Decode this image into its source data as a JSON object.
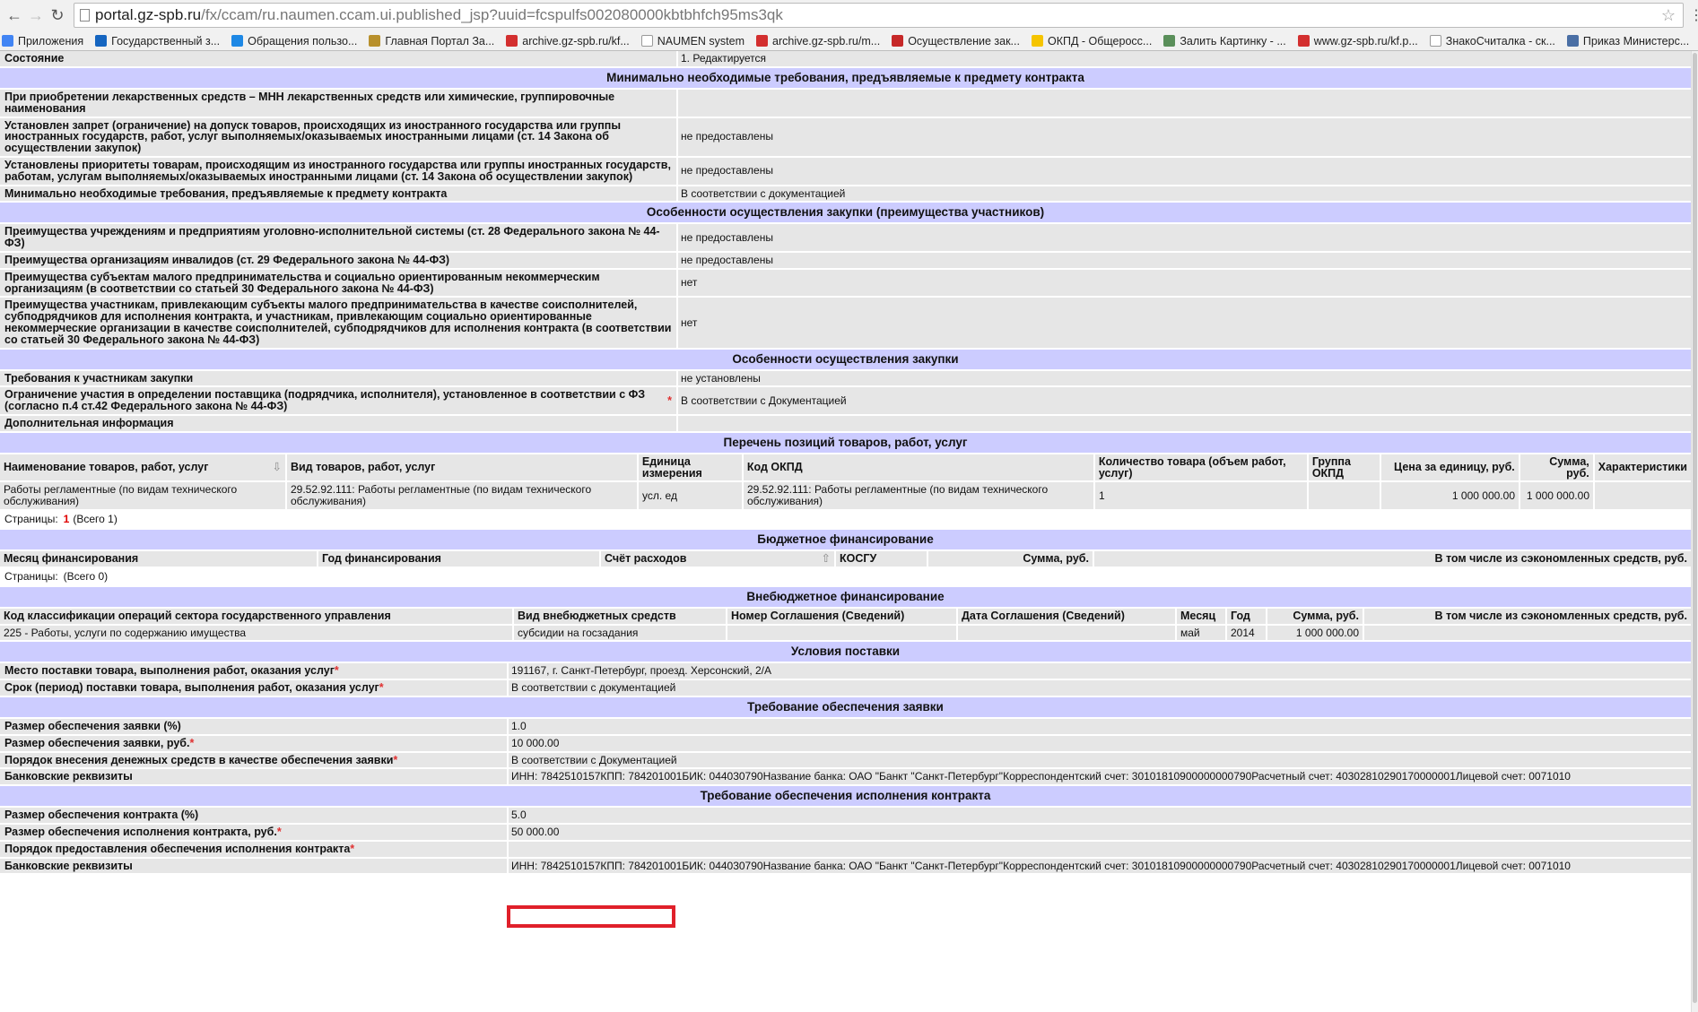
{
  "browser": {
    "url_host": "portal.gz-spb.ru",
    "url_path": "/fx/ccam/ru.naumen.ccam.ui.published_jsp?uuid=fcspulfs002080000kbtbhfch95ms3qk",
    "bookmarks": [
      {
        "label": "Приложения",
        "icon": "apps-icon",
        "color": "#4285f4"
      },
      {
        "label": "Государственный з...",
        "icon": "globe-icon",
        "color": "#1565c0"
      },
      {
        "label": "Обращения пользо...",
        "icon": "help-icon",
        "color": "#1e88e5"
      },
      {
        "label": "Главная Портал За...",
        "icon": "coat-of-arms-icon",
        "color": "#b8902c"
      },
      {
        "label": "archive.gz-spb.ru/kf...",
        "icon": "spb-emblem-icon",
        "color": "#d32f2f"
      },
      {
        "label": "NAUMEN system",
        "icon": "page-icon",
        "color": "#ffffff"
      },
      {
        "label": "archive.gz-spb.ru/m...",
        "icon": "spb-emblem-icon",
        "color": "#d32f2f"
      },
      {
        "label": "Осуществление зак...",
        "icon": "mail-icon",
        "color": "#c62828"
      },
      {
        "label": "ОКПД - Общеросс...",
        "icon": "k-logo-icon",
        "color": "#f5c400"
      },
      {
        "label": "Залить Картинку - ...",
        "icon": "image-icon",
        "color": "#5a8f5a"
      },
      {
        "label": "www.gz-spb.ru/kf.p...",
        "icon": "spb-emblem-icon",
        "color": "#d32f2f"
      },
      {
        "label": "ЗнакоСчиталка - ск...",
        "icon": "page-icon",
        "color": "#ffffff"
      },
      {
        "label": "Приказ Министерс...",
        "icon": "rg-logo-icon",
        "color": "#4a6fa5"
      }
    ]
  },
  "colors": {
    "section_header": "#ccccff",
    "row_bg": "#e6e6e6",
    "required": "#e03030",
    "highlight_box": "#e0202a"
  },
  "status_row": {
    "label": "Состояние",
    "value": "1. Редактируется"
  },
  "min_requirements": {
    "title": "Минимально необходимые требования, предъявляемые к предмету контракта",
    "rows": [
      {
        "label": "При приобретении лекарственных средств – МНН лекарственных средств или химические, группировочные наименования",
        "value": ""
      },
      {
        "label": "Установлен запрет (ограничение) на допуск товаров, происходящих из иностранного государства или группы иностранных государств, работ, услуг выполняемых/оказываемых иностранными лицами (ст. 14 Закона об осуществлении закупок)",
        "value": "не предоставлены"
      },
      {
        "label": "Установлены приоритеты товарам, происходящим из иностранного государства или группы иностранных государств, работам, услугам выполняемых/оказываемых иностранными лицами (ст. 14 Закона об осуществлении закупок)",
        "value": "не предоставлены"
      },
      {
        "label": "Минимально необходимые требования, предъявляемые к предмету контракта",
        "value": "В соответствии с документацией"
      }
    ]
  },
  "advantages": {
    "title": "Особенности осуществления закупки (преимущества участников)",
    "rows": [
      {
        "label": "Преимущества учреждениям и предприятиям уголовно-исполнительной системы (ст. 28 Федерального закона № 44-ФЗ)",
        "value": "не предоставлены"
      },
      {
        "label": "Преимущества организациям инвалидов (ст. 29 Федерального закона № 44-ФЗ)",
        "value": "не предоставлены"
      },
      {
        "label": "Преимущества субъектам малого предпринимательства и социально ориентированным некоммерческим организациям (в соответствии со статьей 30 Федерального закона № 44-ФЗ)",
        "value": "нет"
      },
      {
        "label": "Преимущества участникам, привлекающим субъекты малого предпринимательства в качестве соисполнителей, субподрядчиков для исполнения контракта, и участникам, привлекающим социально ориентированные некоммерческие организации в качестве соисполнителей, субподрядчиков для исполнения контракта (в соответствии со статьей 30 Федерального закона № 44-ФЗ)",
        "value": "нет"
      }
    ]
  },
  "features": {
    "title": "Особенности осуществления закупки",
    "rows": [
      {
        "label": "Требования к участникам закупки",
        "value": "не установлены"
      },
      {
        "label": "Ограничение участия в определении поставщика (подрядчика, исполнителя), установленное в соответствии с ФЗ (согласно п.4 ст.42 Федерального закона № 44-ФЗ)",
        "value": "В соответствии с Документацией",
        "required": "*"
      },
      {
        "label": "Дополнительная информация",
        "value": ""
      }
    ]
  },
  "goods": {
    "title": "Перечень позиций товаров, работ, услуг",
    "columns": [
      "Наименование товаров, работ, услуг",
      "Вид товаров, работ, услуг",
      "Единица измерения",
      "Код ОКПД",
      "Количество товара (объем работ, услуг)",
      "Группа ОКПД",
      "Цена за единицу, руб.",
      "Сумма, руб.",
      "Характеристики"
    ],
    "rows": [
      [
        "Работы регламентные (по видам технического обслуживания)",
        "29.52.92.111: Работы регламентные (по видам технического обслуживания)",
        "усл. ед",
        "29.52.92.111: Работы регламентные (по видам технического обслуживания)",
        "1",
        "",
        "1 000 000.00",
        "1 000 000.00",
        ""
      ]
    ],
    "pager_label": "Страницы:",
    "pager_current": "1",
    "pager_total": "(Всего 1)"
  },
  "budget": {
    "title": "Бюджетное финансирование",
    "columns": [
      "Месяц финансирования",
      "Год финансирования",
      "Счёт расходов",
      "КОСГУ",
      "Сумма, руб.",
      "В том числе из сэкономленных средств, руб."
    ],
    "pager_label": "Страницы:",
    "pager_total": "(Всего 0)"
  },
  "offbudget": {
    "title": "Внебюджетное финансирование",
    "columns": [
      "Код классификации операций сектора государственного управления",
      "Вид внебюджетных средств",
      "Номер Соглашения (Сведений)",
      "Дата Соглашения (Сведений)",
      "Месяц",
      "Год",
      "Сумма, руб.",
      "В том числе из сэкономленных средств, руб."
    ],
    "rows": [
      [
        "225 - Работы, услуги по содержанию имущества",
        "субсидии на госзадания",
        "",
        "",
        "май",
        "2014",
        "1 000 000.00",
        ""
      ]
    ]
  },
  "delivery": {
    "title": "Условия поставки",
    "rows": [
      {
        "label": "Место поставки товара, выполнения работ, оказания услуг",
        "value": "191167, г. Санкт-Петербург, проезд. Херсонский, 2/А",
        "required": "*"
      },
      {
        "label": "Срок (период) поставки товара, выполнения работ, оказания услуг",
        "value": "В соответствии с документацией",
        "required": "*"
      }
    ]
  },
  "bid_security": {
    "title": "Требование обеспечения заявки",
    "rows": [
      {
        "label": "Размер обеспечения заявки (%)",
        "value": "1.0"
      },
      {
        "label": "Размер обеспечения заявки, руб.",
        "value": "10 000.00",
        "required": "*"
      },
      {
        "label": "Порядок внесения денежных средств в качестве обеспечения заявки",
        "value": "В соответствии с Документацией",
        "required": "*"
      }
    ],
    "bank": {
      "label": "Банковские реквизиты",
      "lines": [
        "ИНН: 7842510157",
        "КПП: 784201001",
        "БИК: 044030790",
        "Название банка: ОАО \"Банкт \"Санкт-Петербург\"",
        "Корреспондентский счет: 30101810900000000790",
        "Расчетный счет: 40302810290170000001",
        "Лицевой счет: 0071010"
      ]
    }
  },
  "contract_security": {
    "title": "Требование обеспечения исполнения контракта",
    "rows": [
      {
        "label": "Размер обеспечения контракта (%)",
        "value": "5.0"
      },
      {
        "label": "Размер обеспечения исполнения контракта, руб.",
        "value": "50 000.00",
        "required": "*"
      },
      {
        "label": "Порядок предоставления обеспечения исполнения контракта",
        "value": "",
        "required": "*"
      }
    ],
    "bank": {
      "label": "Банковские реквизиты",
      "lines": [
        "ИНН: 7842510157",
        "КПП: 784201001",
        "БИК: 044030790",
        "Название банка: ОАО \"Банкт \"Санкт-Петербург\"",
        "Корреспондентский счет: 30101810900000000790",
        "Расчетный счет: 40302810290170000001",
        "Лицевой счет: 0071010"
      ]
    }
  }
}
